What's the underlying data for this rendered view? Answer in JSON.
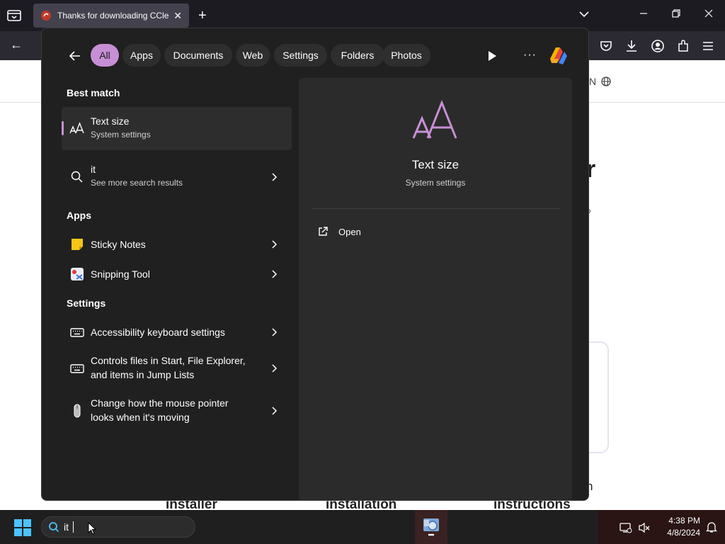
{
  "browser": {
    "tab_title": "Thanks for downloading CCleaner",
    "tab_close": "✕",
    "new_tab": "+",
    "back": "←",
    "minimize": "—",
    "restore": "❐",
    "close": "✕",
    "tab_list": "⌄"
  },
  "webpage": {
    "lang": "N",
    "heading_tail": "r",
    "q": "?",
    "n": "n",
    "steps": [
      "installer",
      "installation",
      "instructions"
    ]
  },
  "search": {
    "filters": [
      "All",
      "Apps",
      "Documents",
      "Web",
      "Settings",
      "Folders",
      "Photos"
    ],
    "active_filter": "All",
    "more": "···",
    "best_match_title": "Best match",
    "best_match": {
      "title": "Text size",
      "subtitle": "System settings",
      "icon": "text-size-icon"
    },
    "web_result": {
      "title": "it",
      "subtitle": "See more search results",
      "icon": "search-icon"
    },
    "apps_title": "Apps",
    "apps": [
      {
        "title": "Sticky Notes",
        "icon": "sticky-notes-icon"
      },
      {
        "title": "Snipping Tool",
        "icon": "snipping-tool-icon"
      }
    ],
    "settings_title": "Settings",
    "settings": [
      {
        "title": "Accessibility keyboard settings",
        "icon": "keyboard-icon"
      },
      {
        "line1": "Controls files in Start, File Explorer,",
        "line2": "and items in Jump Lists",
        "icon": "keyboard-icon"
      },
      {
        "line1": "Change how the mouse pointer",
        "line2": "looks when it's moving",
        "icon": "mouse-icon"
      }
    ],
    "preview": {
      "title": "Text size",
      "subtitle": "System settings",
      "action": "Open"
    }
  },
  "taskbar": {
    "search_text": "it",
    "time": "4:38 PM",
    "date": "4/8/2024"
  },
  "colors": {
    "accent": "#c78fd5",
    "flyout_bg": "#202020",
    "preview_bg": "#2b2b2b"
  }
}
